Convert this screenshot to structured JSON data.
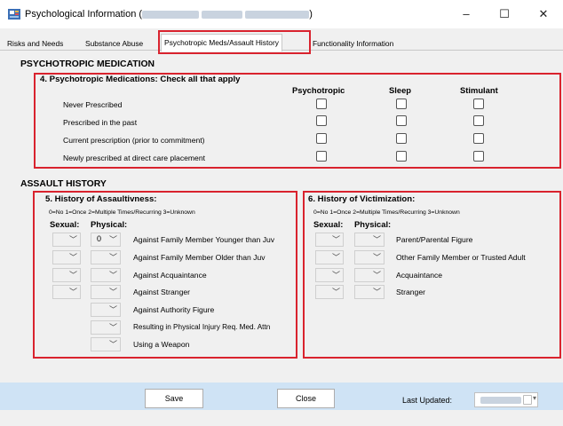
{
  "window": {
    "title_prefix": "Psychological Information (",
    "title_suffix": ")",
    "minimize": "–",
    "maximize": "☐",
    "close": "✕"
  },
  "tabs": [
    {
      "label": "Risks and Needs"
    },
    {
      "label": "Substance Abuse"
    },
    {
      "label": "Psychotropic Meds/Assault History"
    },
    {
      "label": "Functionality Information"
    }
  ],
  "psychotropic": {
    "section_title": "PSYCHOTROPIC MEDICATION",
    "group_title": "4. Psychotropic Medications: Check all that apply",
    "columns": [
      "Psychotropic",
      "Sleep",
      "Stimulant"
    ],
    "rows": [
      "Never Prescribed",
      "Prescribed in the past",
      "Current prescription (prior to commitment)",
      "Newly prescribed at direct care placement"
    ]
  },
  "assault": {
    "section_title": "ASSAULT HISTORY",
    "assaultiveness": {
      "title": "5. History of Assaultivness:",
      "legend": "0=No  1=Once  2=Multiple Times/Recurring  3=Unknown",
      "sexual_label": "Sexual:",
      "physical_label": "Physical:",
      "rows": [
        {
          "label": "Against Family Member Younger than Juv",
          "sexual": "",
          "physical": "0"
        },
        {
          "label": "Against Family Member Older than Juv",
          "sexual": "",
          "physical": ""
        },
        {
          "label": "Against Acquaintance",
          "sexual": "",
          "physical": ""
        },
        {
          "label": "Against Stranger",
          "sexual": "",
          "physical": ""
        },
        {
          "label": "Against Authority Figure",
          "physical": ""
        },
        {
          "label": "Resulting in Physical Injury Req. Med. Attn",
          "physical": ""
        },
        {
          "label": "Using a Weapon",
          "physical": ""
        }
      ]
    },
    "victimization": {
      "title": "6. History of Victimization:",
      "legend": "0=No  1=Once  2=Multiple Times/Recurring  3=Unknown",
      "sexual_label": "Sexual:",
      "physical_label": "Physical:",
      "rows": [
        {
          "label": "Parent/Parental Figure"
        },
        {
          "label": "Other Family Member or Trusted Adult"
        },
        {
          "label": "Acquaintance"
        },
        {
          "label": "Stranger"
        }
      ]
    }
  },
  "footer": {
    "save": "Save",
    "close": "Close",
    "last_updated_label": "Last Updated:"
  },
  "colors": {
    "highlight": "#d9232e",
    "footer_bar": "#cfe3f5"
  }
}
